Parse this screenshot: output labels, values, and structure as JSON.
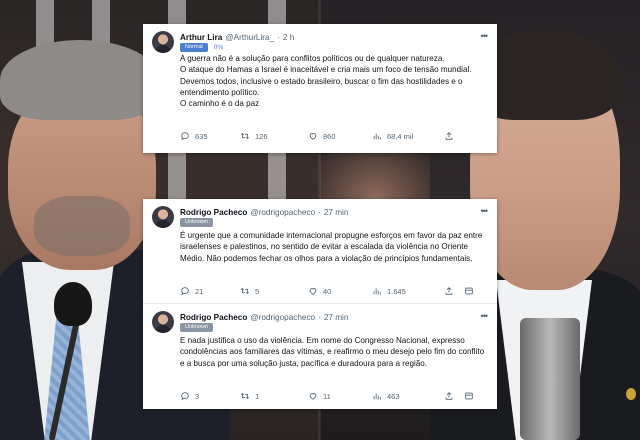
{
  "tweets": [
    {
      "name": "Arthur Lira",
      "handle": "@ArthurLira_",
      "separator": "·",
      "time": "2 h",
      "badge": "Normal",
      "badge_pct": "0%",
      "text": "A guerra não é a solução para conflitos políticos ou de qualquer natureza.\nO ataque do Hamas a Israel é inaceitável e cria mais um foco de tensão mundial.\nDevemos todos, inclusive o estado brasileiro, buscar o fim das hostilidades e  o entendimento político.\nO caminho é o da paz",
      "replies": "635",
      "retweets": "126",
      "likes": "860",
      "views": "68,4 mil"
    },
    {
      "name": "Rodrigo Pacheco",
      "handle": "@rodrigopacheco",
      "separator": "·",
      "time": "27 min",
      "badge": "Unknown",
      "text": "É urgente que a comunidade internacional propugne esforços em favor da paz entre israelenses e palestinos, no sentido de evitar a escalada da violência no Oriente Médio. Não podemos fechar os olhos para a violação de princípios fundamentais.",
      "replies": "21",
      "retweets": "5",
      "likes": "40",
      "views": "1.645"
    },
    {
      "name": "Rodrigo Pacheco",
      "handle": "@rodrigopacheco",
      "separator": "·",
      "time": "27 min",
      "badge": "Unknown",
      "text": "E nada justifica o uso da violência. Em nome do Congresso Nacional, expresso condolências aos familiares das vítimas, e reafirmo o meu desejo pelo fim do conflito e a busca por uma solução justa, pacífica e duradoura para a região.",
      "replies": "3",
      "retweets": "1",
      "likes": "11",
      "views": "463"
    }
  ],
  "icons": [
    "reply-icon",
    "retweet-icon",
    "like-icon",
    "views-icon",
    "share-icon",
    "bookmark-icon",
    "more-icon"
  ],
  "colors": {
    "badge_normal": "#4a7fd1",
    "badge_unknown": "#8a96a3",
    "text": "#0f1419",
    "muted": "#536471"
  }
}
